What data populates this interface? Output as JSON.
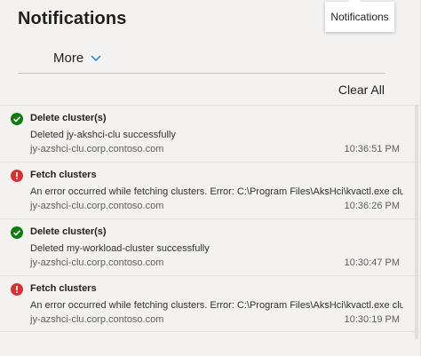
{
  "header": {
    "title": "Notifications",
    "tooltip": "Notifications"
  },
  "toolbar": {
    "more_label": "More",
    "clear_all_label": "Clear All"
  },
  "colors": {
    "success": "#107c10",
    "error": "#d13438"
  },
  "notifications": [
    {
      "status": "success",
      "icon": "success-check-icon",
      "title": "Delete cluster(s)",
      "message": "Deleted jy-akshci-clu successfully",
      "host": "jy-azshci-clu.corp.contoso.com",
      "time": "10:36:51 PM"
    },
    {
      "status": "error",
      "icon": "error-exclamation-icon",
      "title": "Fetch clusters",
      "message": "An error occurred while fetching clusters. Error: C:\\Program Files\\AksHci\\kvactl.exe clust",
      "host": "jy-azshci-clu.corp.contoso.com",
      "time": "10:36:26 PM"
    },
    {
      "status": "success",
      "icon": "success-check-icon",
      "title": "Delete cluster(s)",
      "message": "Deleted my-workload-cluster successfully",
      "host": "jy-azshci-clu.corp.contoso.com",
      "time": "10:30:47 PM"
    },
    {
      "status": "error",
      "icon": "error-exclamation-icon",
      "title": "Fetch clusters",
      "message": "An error occurred while fetching clusters. Error: C:\\Program Files\\AksHci\\kvactl.exe clust",
      "host": "jy-azshci-clu.corp.contoso.com",
      "time": "10:30:19 PM"
    }
  ]
}
